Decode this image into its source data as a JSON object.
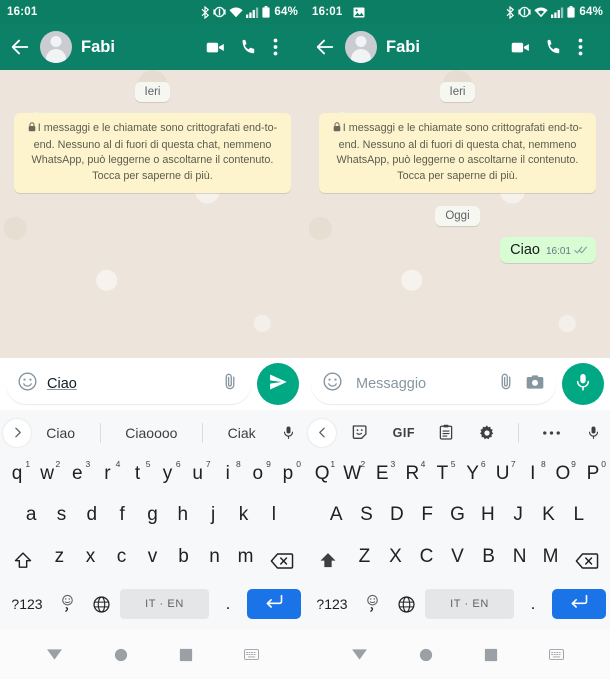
{
  "status_bar": {
    "time": "16:01",
    "battery": "64%",
    "icons_left_pane": [
      "bluetooth-icon",
      "vibrate-icon",
      "wifi-icon",
      "signal-icon",
      "battery-icon"
    ],
    "icons_right_pane": [
      "screenshot-icon",
      "bluetooth-icon",
      "vibrate-icon",
      "wifi-icon",
      "signal-icon",
      "battery-icon"
    ]
  },
  "header": {
    "contact_name": "Fabi",
    "back_icon": "back-arrow-icon",
    "avatar_icon": "contact-avatar",
    "video_call_icon": "video-call-icon",
    "voice_call_icon": "phone-call-icon",
    "overflow_icon": "more-options-icon",
    "bg_color": "#0c8168"
  },
  "chat_left": {
    "date_divider": "Ieri",
    "encryption_notice": "I messaggi e le chiamate sono crittografati end-to-end. Nessuno al di fuori di questa chat, nemmeno WhatsApp, può leggerne o ascoltarne il contenuto. Tocca per saperne di più.",
    "lock_icon": "lock-icon"
  },
  "chat_right": {
    "date_divider_yesterday": "Ieri",
    "encryption_notice": "I messaggi e le chiamate sono crittografati end-to-end. Nessuno al di fuori di questa chat, nemmeno WhatsApp, può leggerne o ascoltarne il contenuto. Tocca per saperne di più.",
    "lock_icon": "lock-icon",
    "date_divider_today": "Oggi",
    "message": {
      "text": "Ciao",
      "time": "16:01",
      "status": "read",
      "ticks_icon": "double-check-icon"
    }
  },
  "composer_left": {
    "emoji_icon": "emoji-icon",
    "value": "Ciao",
    "attach_icon": "attachment-icon",
    "action_button": "send-icon",
    "action_color": "#00a884"
  },
  "composer_right": {
    "emoji_icon": "emoji-icon",
    "placeholder": "Messaggio",
    "attach_icon": "attachment-icon",
    "camera_icon": "camera-icon",
    "action_button": "microphone-icon",
    "action_color": "#00a884"
  },
  "suggestion_bar": {
    "expand_icon": "chevron-right-icon",
    "suggestions": [
      "Ciao",
      "Ciaoooo",
      "Ciak"
    ],
    "mic_icon": "microphone-icon"
  },
  "toolbar_right": {
    "collapse_icon": "chevron-left-icon",
    "tools": [
      {
        "name": "sticker-icon",
        "label": ""
      },
      {
        "name": "gif-icon",
        "label": "GIF"
      },
      {
        "name": "clipboard-icon",
        "label": ""
      },
      {
        "name": "settings-gear-icon",
        "label": ""
      },
      {
        "name": "more-ellipsis-icon",
        "label": ""
      }
    ],
    "mic_icon": "microphone-icon"
  },
  "keyboard_left": {
    "case": "lowercase",
    "shift_state": "off",
    "row1": [
      {
        "key": "q",
        "hint": "1"
      },
      {
        "key": "w",
        "hint": "2"
      },
      {
        "key": "e",
        "hint": "3"
      },
      {
        "key": "r",
        "hint": "4"
      },
      {
        "key": "t",
        "hint": "5"
      },
      {
        "key": "y",
        "hint": "6"
      },
      {
        "key": "u",
        "hint": "7"
      },
      {
        "key": "i",
        "hint": "8"
      },
      {
        "key": "o",
        "hint": "9"
      },
      {
        "key": "p",
        "hint": "0"
      }
    ],
    "row2": [
      "a",
      "s",
      "d",
      "f",
      "g",
      "h",
      "j",
      "k",
      "l"
    ],
    "row3": [
      "z",
      "x",
      "c",
      "v",
      "b",
      "n",
      "m"
    ],
    "shift_icon": "shift-outline-icon",
    "backspace_icon": "backspace-icon",
    "numbers_key": "?123",
    "emoji_key": "emoji-comma-key",
    "globe_key": "language-globe-icon",
    "spacebar": "IT · EN",
    "period_key": ".",
    "enter_icon": "enter-icon",
    "enter_color": "#1b73e8"
  },
  "keyboard_right": {
    "case": "uppercase",
    "shift_state": "on",
    "row1": [
      {
        "key": "Q",
        "hint": "1"
      },
      {
        "key": "W",
        "hint": "2"
      },
      {
        "key": "E",
        "hint": "3"
      },
      {
        "key": "R",
        "hint": "4"
      },
      {
        "key": "T",
        "hint": "5"
      },
      {
        "key": "Y",
        "hint": "6"
      },
      {
        "key": "U",
        "hint": "7"
      },
      {
        "key": "I",
        "hint": "8"
      },
      {
        "key": "O",
        "hint": "9"
      },
      {
        "key": "P",
        "hint": "0"
      }
    ],
    "row2": [
      "A",
      "S",
      "D",
      "F",
      "G",
      "H",
      "J",
      "K",
      "L"
    ],
    "row3": [
      "Z",
      "X",
      "C",
      "V",
      "B",
      "N",
      "M"
    ],
    "shift_icon": "shift-filled-icon",
    "backspace_icon": "backspace-icon",
    "numbers_key": "?123",
    "emoji_key": "emoji-comma-key",
    "globe_key": "language-globe-icon",
    "spacebar": "IT · EN",
    "period_key": ".",
    "enter_icon": "enter-icon",
    "enter_color": "#1b73e8"
  },
  "nav_bar": {
    "items": [
      "back-triangle-icon",
      "home-circle-icon",
      "recents-square-icon",
      "keyboard-toggle-icon"
    ]
  }
}
